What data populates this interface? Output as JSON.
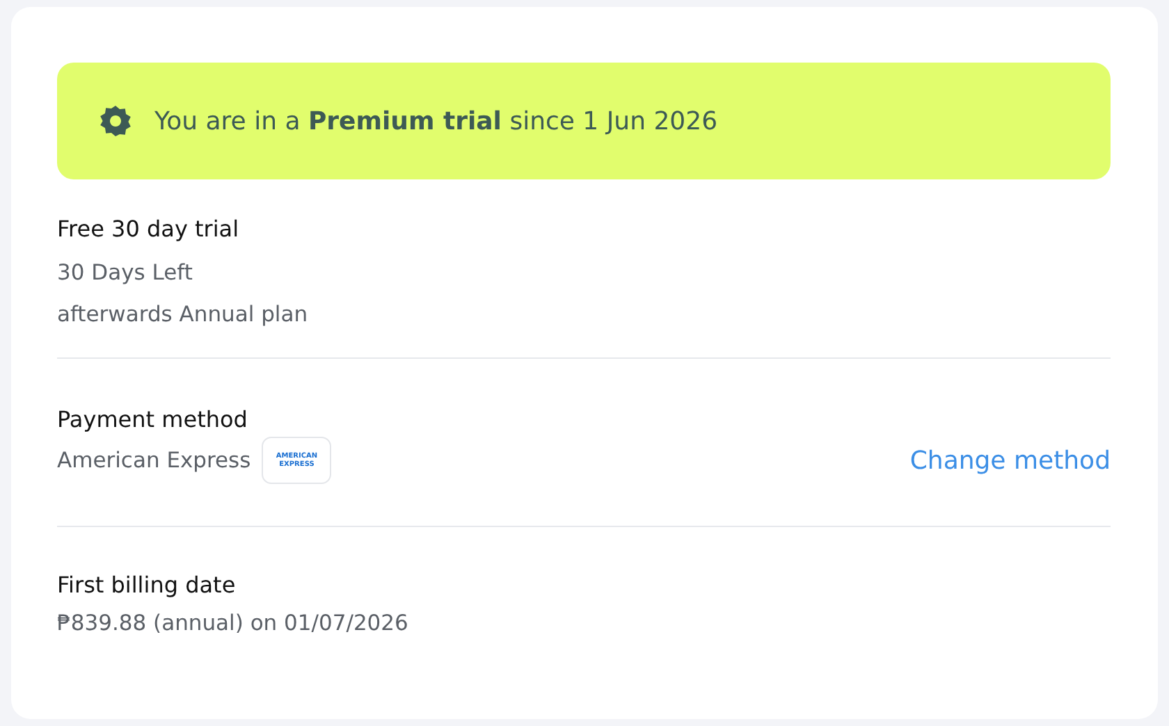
{
  "banner": {
    "text": "You are in a **Premium trial** since 1 Jun 2026"
  },
  "trial": {
    "title": "Free 30 day trial",
    "lines": [
      "30 Days Left",
      "afterwards Annual plan"
    ]
  },
  "payment": {
    "title": "Payment method",
    "card_name": "American Express",
    "card_logo": [
      "AMERICAN",
      "EXPRESS"
    ],
    "action": "Change method"
  },
  "billing": {
    "title": "First billing date",
    "text": "₱839.88 (annual) on 01/07/2026"
  }
}
